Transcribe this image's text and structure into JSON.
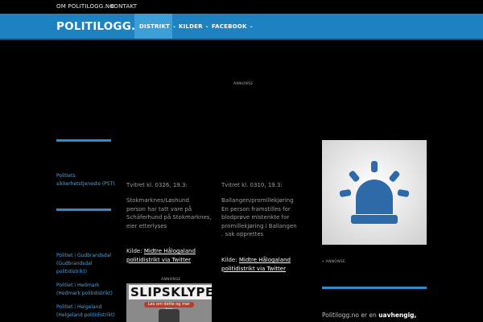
{
  "topbar": {
    "about": "OM POLITILOGG.NO",
    "contact": "KONTAKT"
  },
  "nav": {
    "brand": "POLITILOGG.NO",
    "items": [
      {
        "label": "DISTRIKT",
        "caret": "⌄"
      },
      {
        "label": "KILDER",
        "caret": "⌄"
      },
      {
        "label": "FACEBOOK",
        "caret": "⌄"
      }
    ]
  },
  "ads": {
    "top_label": "ANNONSE",
    "mid_label": "ANNONSE",
    "right_label": "• ANNONSE"
  },
  "sidebar": {
    "links": [
      {
        "line1": "Politiets",
        "line2": "sikkerhetstjeneste (PST)"
      },
      {
        "line1": "Politiet i Gudbrandsdal",
        "line2": "(Gudbrandsdal",
        "line3": "politidistrikt)"
      },
      {
        "line1": "Politiet i Hedmark",
        "line2": "(Hedmark politidistrikt)"
      },
      {
        "line1": "Politiet i Helgeland",
        "line2": "(Helgeland politidistrikt)"
      }
    ]
  },
  "posts": [
    {
      "timestamp": "Tvitret kl. 0326, 19.3:",
      "body": [
        "Stokmarknes/Løshund",
        "person har tatt vare på",
        "Schäferhund på Stokmarknes,",
        "eier etterlyses"
      ],
      "source_prefix": "Kilde: ",
      "source_link_1": "Midtre Hålogaland",
      "source_link_2": "politidistrikt via Twitter"
    },
    {
      "timestamp": "Tvitret kl. 0310, 19.3:",
      "body": [
        "Ballangen/promillekjøring",
        "En person framstilles for",
        "blodprøve mistenkte for",
        "promillekjøring i Ballangen",
        ". sak opprettes"
      ],
      "source_prefix": "Kilde: ",
      "source_link_1": "Midtre Hålogaland",
      "source_link_2": "politidistrikt via Twitter"
    }
  ],
  "ad_box": {
    "headline": "SLIPSKLYPE?",
    "subline": "Les om dette og mer her"
  },
  "footer": {
    "prefix": "Politilogg.no er en ",
    "bold": "uavhengig,"
  },
  "colors": {
    "nav_blue": "#1e82c0",
    "nav_active": "#3d9fd8",
    "link_blue": "#4da3df",
    "siren_blue": "#2f6aa8"
  },
  "icons": {
    "promo": "police-siren-icon"
  }
}
